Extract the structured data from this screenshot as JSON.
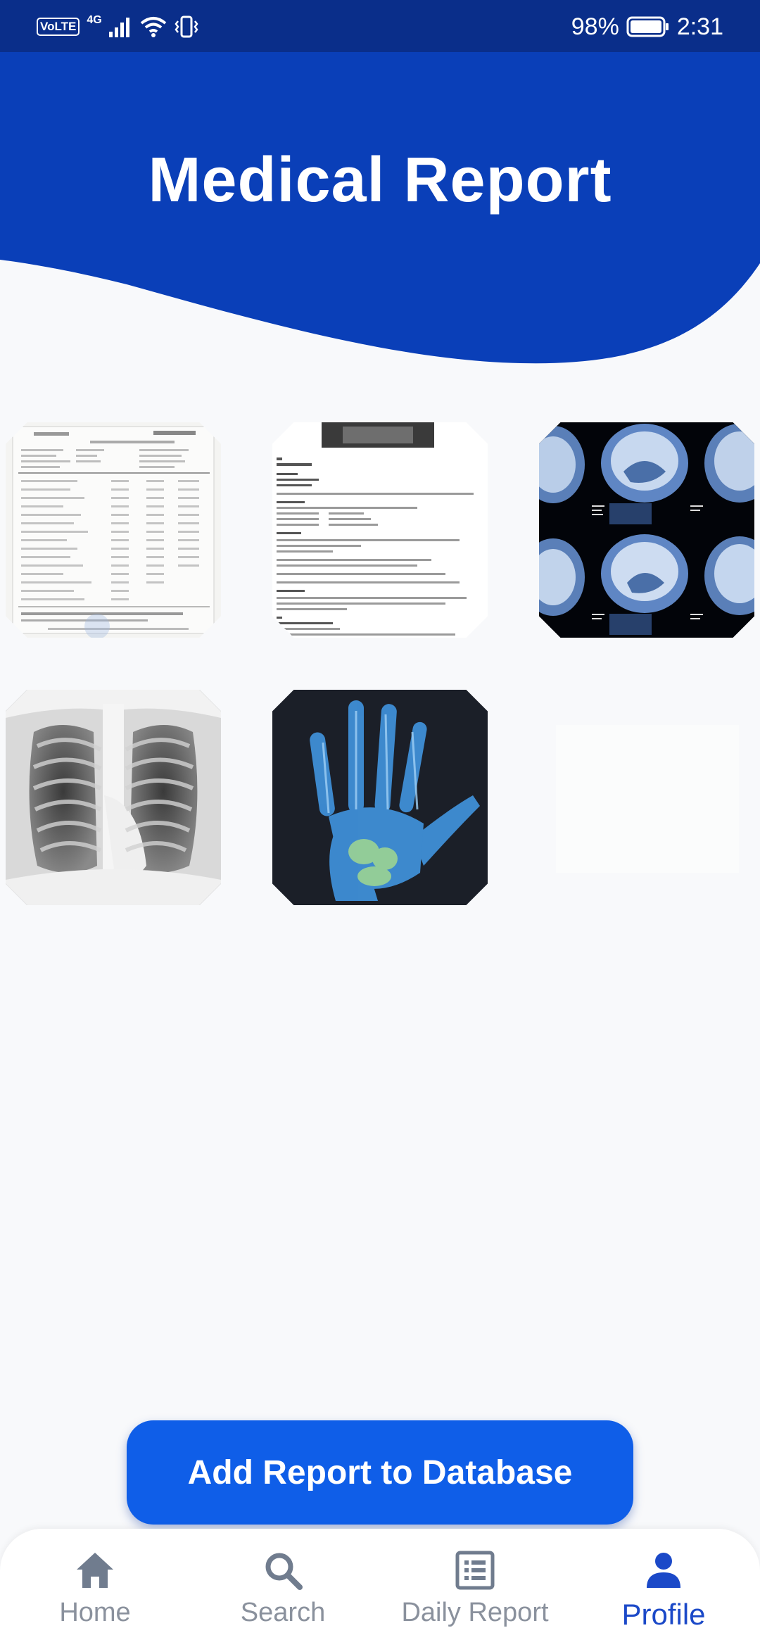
{
  "status_bar": {
    "volte": "VoLTE",
    "network": "4G",
    "battery": "98%",
    "time": "2:31"
  },
  "header": {
    "title": "Medical Report"
  },
  "gallery": {
    "items": [
      {
        "kind": "lab-report-document"
      },
      {
        "kind": "text-report-document"
      },
      {
        "kind": "brain-mri-scan"
      },
      {
        "kind": "chest-xray"
      },
      {
        "kind": "hand-xray"
      }
    ]
  },
  "actions": {
    "add_report_label": "Add Report to Database"
  },
  "bottom_nav": {
    "items": [
      {
        "label": "Home",
        "icon": "home-icon"
      },
      {
        "label": "Search",
        "icon": "search-icon"
      },
      {
        "label": "Daily Report",
        "icon": "list-icon"
      },
      {
        "label": "Profile",
        "icon": "person-icon",
        "active": true
      }
    ]
  },
  "colors": {
    "primary": "#0a3fb8",
    "button": "#0f5ee8",
    "active_nav": "#1b49c8",
    "inactive_nav": "#8a919d"
  }
}
